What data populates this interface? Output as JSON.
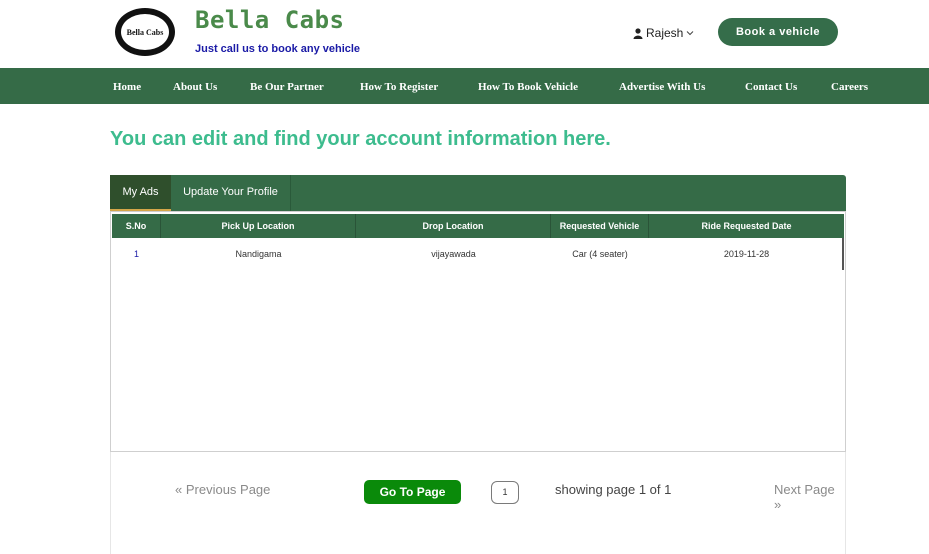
{
  "brand": {
    "logo_text": "Bella Cabs",
    "title": "Bella Cabs",
    "tagline": "Just call us to book any vehicle"
  },
  "user": {
    "name": "Rajesh",
    "icon": "user-icon"
  },
  "header": {
    "book_button": "Book a vehicle"
  },
  "nav": {
    "items": [
      "Home",
      "About Us",
      "Be Our Partner",
      "How To Register",
      "How To Book Vehicle",
      "Advertise With Us",
      "Contact Us",
      "Careers"
    ]
  },
  "page": {
    "heading": "You can edit and find your account information here."
  },
  "tabs": [
    {
      "label": "My Ads",
      "active": true
    },
    {
      "label": "Update Your Profile",
      "active": false
    }
  ],
  "table": {
    "columns": [
      "S.No",
      "Pick Up Location",
      "Drop Location",
      "Requested Vehicle",
      "Ride Requested Date"
    ],
    "rows": [
      [
        "1",
        "Nandigama",
        "vijayawada",
        "Car (4 seater)",
        "2019-11-28"
      ]
    ]
  },
  "pagination": {
    "prev_label": "« Previous Page",
    "goto_label": "Go To Page",
    "page_value": "1",
    "showing_text": "showing page 1 of 1",
    "next_label": "Next Page »"
  },
  "colors": {
    "nav_bg": "#356b47",
    "heading": "#3dbc8e",
    "goto_button": "#0a8a0a",
    "tagline": "#1a1aa6"
  }
}
